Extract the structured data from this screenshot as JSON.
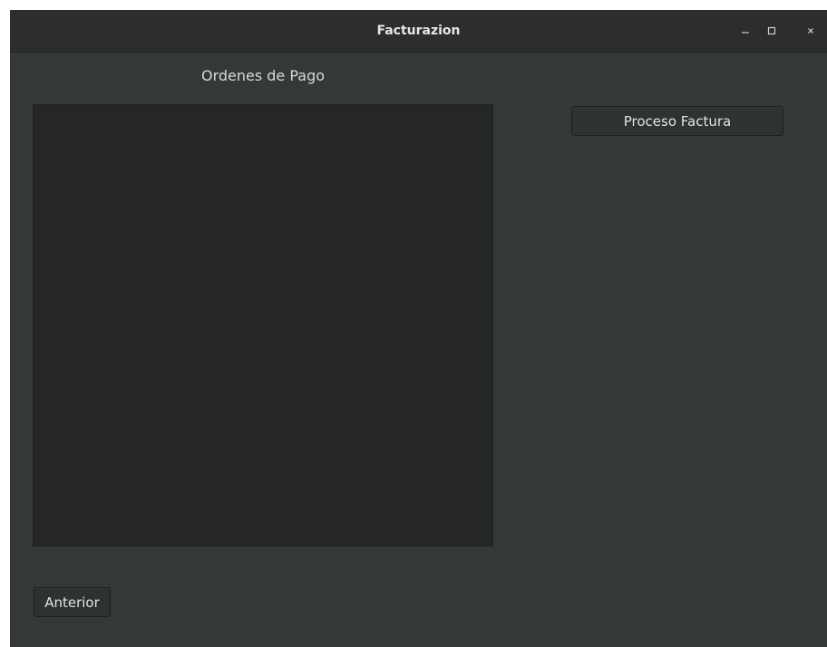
{
  "window": {
    "title": "Facturazion"
  },
  "main": {
    "list_label": "Ordenes de Pago",
    "process_button_label": "Proceso Factura",
    "previous_button_label": "Anterior"
  },
  "icons": {
    "minimize": "minimize-icon",
    "maximize": "maximize-icon",
    "close": "close-icon"
  }
}
